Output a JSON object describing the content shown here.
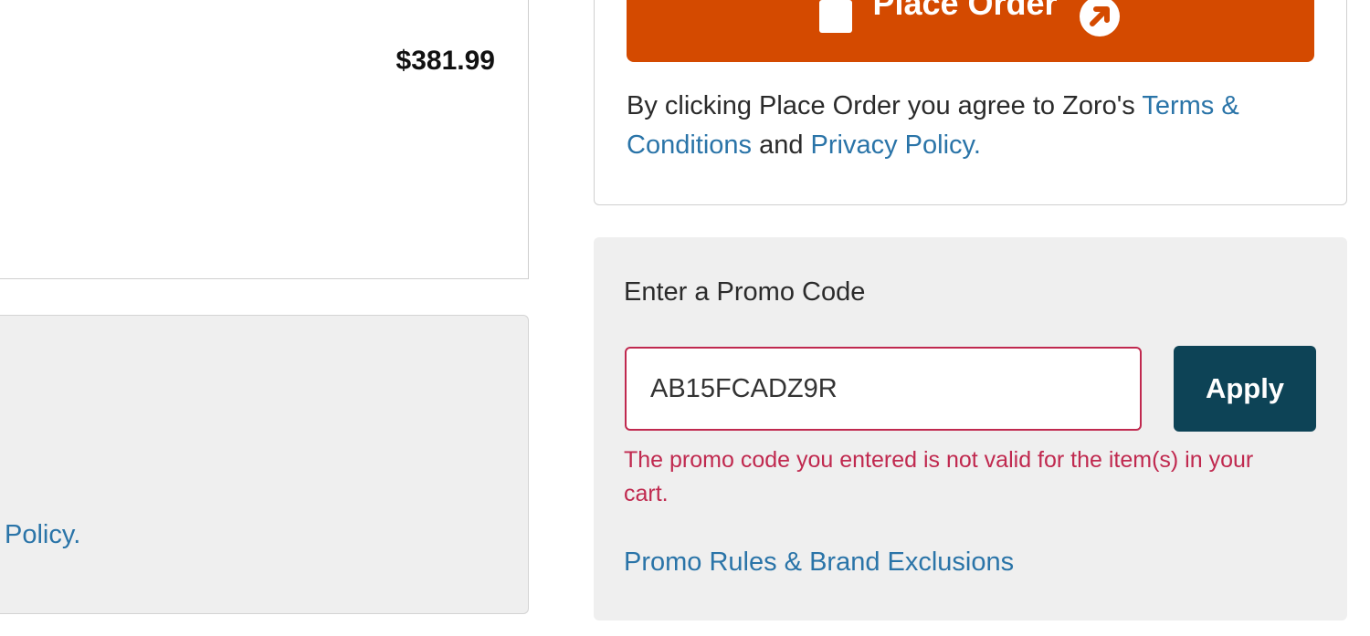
{
  "order_summary": {
    "total": "$381.99"
  },
  "left_info": {
    "partial_link": "Policy."
  },
  "place_order": {
    "button_label": "Place Order",
    "legal": {
      "prefix": "By clicking Place Order you agree to Zoro's ",
      "terms_link": "Terms & Conditions",
      "middle": " and ",
      "privacy_link": "Privacy Policy."
    }
  },
  "promo": {
    "heading": "Enter a Promo Code",
    "input_value": "AB15FCADZ9R",
    "apply_label": "Apply",
    "error": "The promo code you entered is not valid for the item(s) in your cart.",
    "rules_link": "Promo Rules & Brand Exclusions"
  },
  "colors": {
    "place_order_bg": "#d44a00",
    "apply_bg": "#0d4356",
    "link": "#2a74a8",
    "error": "#c0294f"
  }
}
